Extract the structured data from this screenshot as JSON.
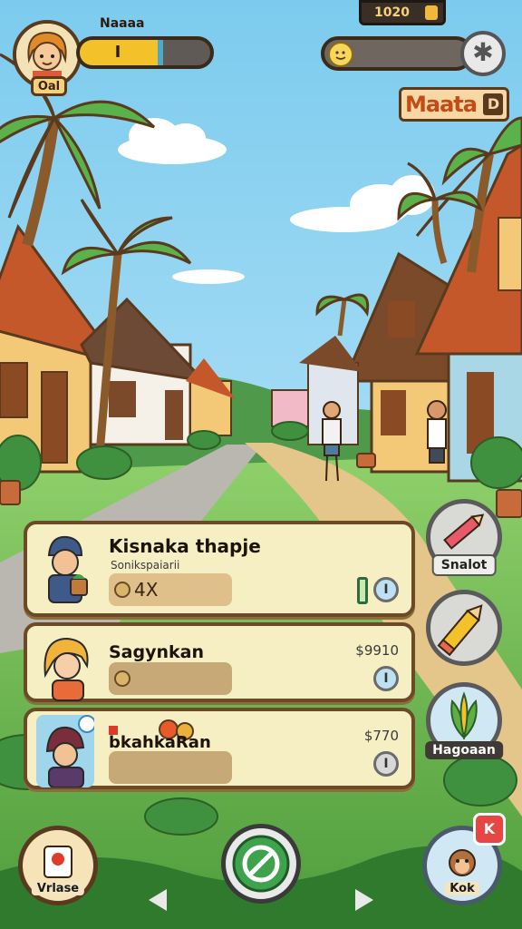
{
  "hud": {
    "player_name": "Oal",
    "hp_label": "Naaaa",
    "hp_value": "I",
    "hp_fill": 0.6,
    "coins": "1020",
    "brand": "Maata",
    "brand_badge": "D"
  },
  "cards": [
    {
      "title": "Kisnaka thapje",
      "subtitle": "Sonikspaiarii",
      "stat": "4X",
      "price": "",
      "button": "I"
    },
    {
      "title": "Sagynkan",
      "subtitle": "",
      "stat": "",
      "price": "$9910",
      "button": "I"
    },
    {
      "title": "bkahkaRan",
      "subtitle": "",
      "stat": "",
      "price": "$770",
      "button": "I"
    }
  ],
  "side_buttons": [
    {
      "label": "Snalot"
    },
    {
      "label": ""
    },
    {
      "label": "Hagoaan"
    }
  ],
  "bottom": {
    "left_label": "Vrlase",
    "right_label": "Kok",
    "right_badge": "K"
  },
  "colors": {
    "accent": "#f3c22b",
    "card_bg": "#f6efc4",
    "card_border": "#6b4a26",
    "action_green": "#3fa34d"
  },
  "icons": {
    "settings": "settings-icon",
    "pencil": "pencil-icon",
    "leaf": "leaf-icon",
    "play": "play-icon"
  }
}
